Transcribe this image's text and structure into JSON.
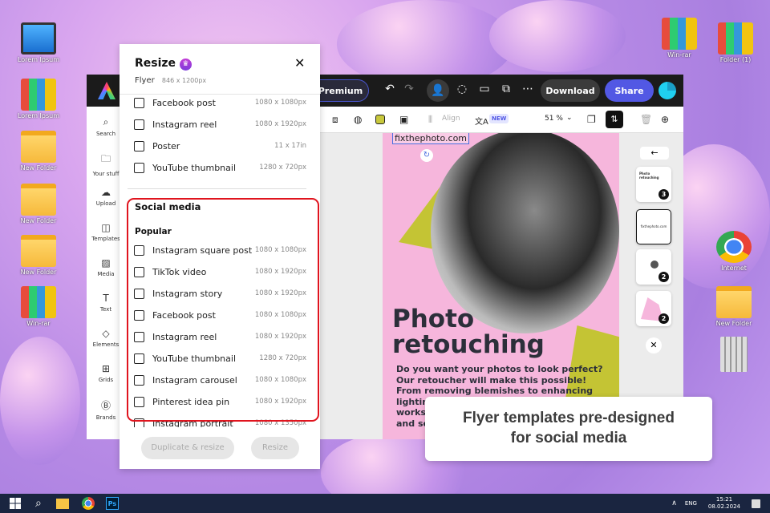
{
  "desktop": {
    "left_icons": [
      {
        "label": "Lorem Ipsum",
        "type": "computer"
      },
      {
        "label": "Lorem Ipsum",
        "type": "binder"
      },
      {
        "label": "New Folder",
        "type": "folder"
      },
      {
        "label": "New Folder",
        "type": "folder"
      },
      {
        "label": "New Folder",
        "type": "folder"
      },
      {
        "label": "Win-rar",
        "type": "winrar"
      }
    ],
    "right_icons": [
      {
        "label": "Win-rar",
        "type": "winrar"
      },
      {
        "label": "Folder (1)",
        "type": "binder"
      },
      {
        "label": "Internet",
        "type": "chrome"
      },
      {
        "label": "New Folder",
        "type": "folder"
      },
      {
        "label": "",
        "type": "recycle-bin"
      }
    ]
  },
  "header": {
    "premium_label": "y Premium",
    "download_label": "Download",
    "share_label": "Share",
    "accent": "#5258e4"
  },
  "toolbar": {
    "align_label": "Align",
    "new_badge": "NEW",
    "zoom": "51 %"
  },
  "sidebar": {
    "items": [
      "Search",
      "Your stuff",
      "Upload",
      "Templates",
      "Media",
      "Text",
      "Elements",
      "Grids",
      "Brands"
    ]
  },
  "resize_panel": {
    "title": "Resize",
    "doc_type": "Flyer",
    "doc_size": "846 x 1200px",
    "top_items": [
      {
        "label": "Facebook post",
        "size": "1080 x 1080px"
      },
      {
        "label": "Instagram reel",
        "size": "1080 x 1920px"
      },
      {
        "label": "Poster",
        "size": "11 x 17in"
      },
      {
        "label": "YouTube thumbnail",
        "size": "1280 x 720px"
      }
    ],
    "section": "Social media",
    "subsection": "Popular",
    "items": [
      {
        "label": "Instagram square post",
        "size": "1080 x 1080px"
      },
      {
        "label": "TikTok video",
        "size": "1080 x 1920px"
      },
      {
        "label": "Instagram story",
        "size": "1080 x 1920px"
      },
      {
        "label": "Facebook post",
        "size": "1080 x 1080px"
      },
      {
        "label": "Instagram reel",
        "size": "1080 x 1920px"
      },
      {
        "label": "YouTube thumbnail",
        "size": "1280 x 720px"
      },
      {
        "label": "Instagram carousel",
        "size": "1080 x 1080px"
      },
      {
        "label": "Pinterest idea pin",
        "size": "1080 x 1920px"
      },
      {
        "label": "Instagram portrait",
        "size": "1080 x 1350px"
      }
    ],
    "duplicate_label": "Duplicate & resize",
    "resize_label": "Resize",
    "highlight": "#e0141e"
  },
  "flyer": {
    "url": "fixthephoto.com",
    "headline1": "Photo",
    "headline2": "retouching",
    "body": "Do you want your photos to look perfect? Our retoucher will make this possible! From removing blemishes to enhancing lighting, we'll turn your photos into works of art. Trust us with your photos and see their full potential."
  },
  "pages": [
    {
      "title": "Photo retouching",
      "badge": "3"
    },
    {
      "title": "fixthephoto.com",
      "badge": ""
    },
    {
      "title": "",
      "badge": "2"
    },
    {
      "title": "",
      "badge": "2"
    }
  ],
  "caption": {
    "line1": "Flyer templates pre-designed",
    "line2": "for social media"
  },
  "taskbar": {
    "lang": "ENG",
    "time": "15:21",
    "date": "08.02.2024"
  }
}
